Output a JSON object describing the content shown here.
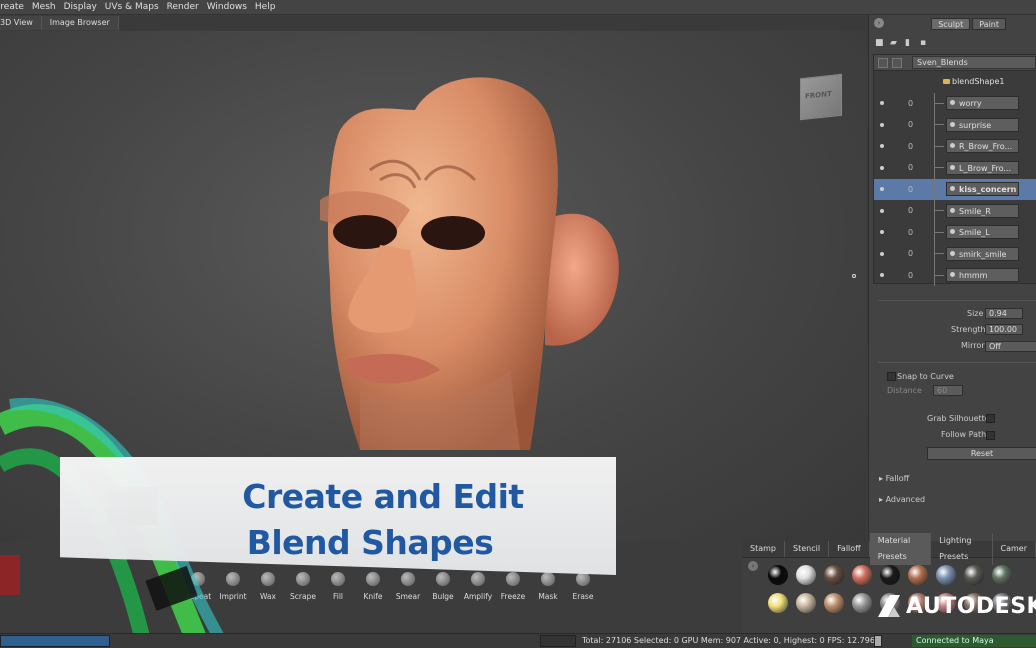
{
  "menu": [
    "Create",
    "Mesh",
    "Display",
    "UVs & Maps",
    "Render",
    "Windows",
    "Help"
  ],
  "view_tabs": [
    "3D View",
    "Image Browser"
  ],
  "viewcube_label": "FRONT",
  "panel": {
    "mode_tabs": [
      "Sculpt",
      "Paint"
    ],
    "layers": {
      "root": "Sven_Blends",
      "group": "blendShape1",
      "rows": [
        {
          "value": "0",
          "name": "worry"
        },
        {
          "value": "0",
          "name": "surprise"
        },
        {
          "value": "0",
          "name": "R_Brow_Fro..."
        },
        {
          "value": "0",
          "name": "L_Brow_Fro..."
        },
        {
          "value": "0",
          "name": "kiss_concern",
          "selected": true
        },
        {
          "value": "0",
          "name": "Smile_R"
        },
        {
          "value": "0",
          "name": "Smile_L"
        },
        {
          "value": "0",
          "name": "smirk_smile"
        },
        {
          "value": "0",
          "name": "hmmm"
        }
      ]
    },
    "props": {
      "size_label": "Size",
      "size_value": "0.94",
      "strength_label": "Strength",
      "strength_value": "100.00",
      "mirror_label": "Mirror",
      "mirror_value": "Off",
      "snap_label": "Snap to Curve",
      "distance_label": "Distance",
      "distance_value": "60",
      "grab_label": "Grab Silhouette",
      "follow_label": "Follow Path",
      "reset_label": "Reset",
      "falloff_label": "Falloff",
      "advanced_label": "Advanced"
    }
  },
  "material_tabs": [
    "Stamp",
    "Stencil",
    "Falloff",
    "Material Presets",
    "Lighting Presets",
    "Camer"
  ],
  "materials_row1": [
    "#0a0a0a",
    "#e0e0e0",
    "#6a5040",
    "#d07060",
    "#1a1a1a",
    "#b07050",
    "#7a90b0",
    "#5a5a55",
    "#607060"
  ],
  "materials_row2": [
    "#f2e07a",
    "#c8b8a0",
    "#c09070",
    "#9a9a9a",
    "#8a8a8a",
    "#b08070",
    "#c08080",
    "#8a7060",
    "#7a7a80"
  ],
  "tools": [
    "Repeat",
    "Imprint",
    "Wax",
    "Scrape",
    "Fill",
    "Knife",
    "Smear",
    "Bulge",
    "Amplify",
    "Freeze",
    "Mask",
    "Erase"
  ],
  "banner": {
    "line1": "Create and Edit",
    "line2": "Blend Shapes"
  },
  "status": {
    "text": "Total: 27106  Selected: 0 GPU Mem: 907  Active: 0, Highest: 0  FPS: 12.7962",
    "connected": "Connected to Maya"
  },
  "logo": "AUTODESK"
}
